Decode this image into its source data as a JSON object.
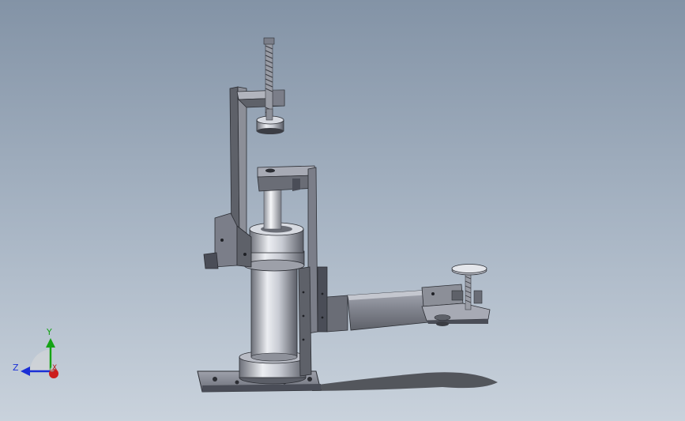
{
  "viewport": {
    "background_top": "#8393a6",
    "background_bottom": "#c9d2dc"
  },
  "model": {
    "colors": {
      "steel_dark": "#4a4d57",
      "steel_mid": "#7b7e89",
      "steel_light": "#c8cbd3",
      "steel_highlight": "#eceef2",
      "edge": "#2b2d33",
      "shadow": "#3f4147"
    }
  },
  "triad": {
    "y_label": "Y",
    "z_label": "Z",
    "x_label": "X",
    "y_color": "#15a315",
    "z_color": "#1a2fd6",
    "x_color": "#cc1d1d"
  }
}
